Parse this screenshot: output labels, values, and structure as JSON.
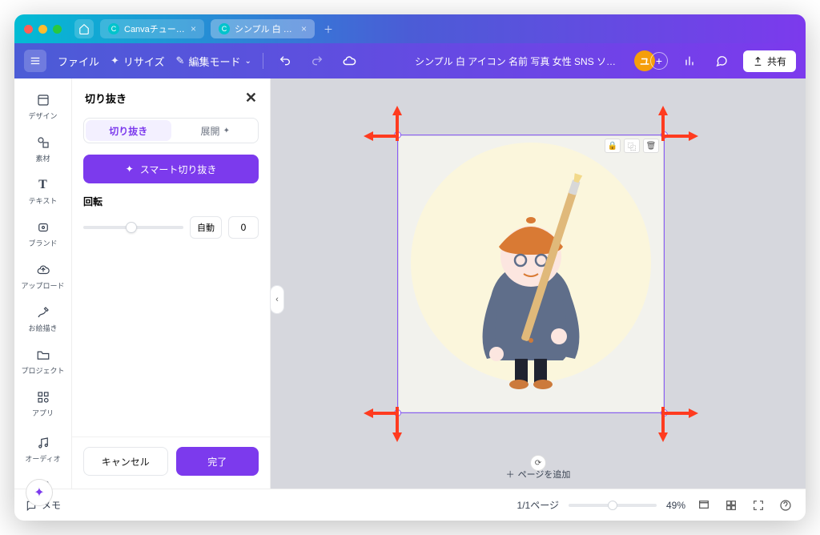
{
  "tabs": [
    {
      "label": "Canvaチュートリア…"
    },
    {
      "label": "シンプル 白 アイ…"
    }
  ],
  "toolbar": {
    "file": "ファイル",
    "resize": "リサイズ",
    "editmode": "編集モード",
    "docname": "シンプル 白 アイコン 名前 写真 女性 SNS ソーシャル…",
    "avatar": "ユ",
    "share": "共有"
  },
  "rail": [
    {
      "name": "design",
      "label": "デザイン",
      "icon": "▭"
    },
    {
      "name": "elements",
      "label": "素材",
      "icon": "✦"
    },
    {
      "name": "text",
      "label": "テキスト",
      "icon": "T"
    },
    {
      "name": "brand",
      "label": "ブランド",
      "icon": "🅱"
    },
    {
      "name": "upload",
      "label": "アップロード",
      "icon": "☁"
    },
    {
      "name": "draw",
      "label": "お絵描き",
      "icon": "✎"
    },
    {
      "name": "project",
      "label": "プロジェクト",
      "icon": "🗀"
    },
    {
      "name": "apps",
      "label": "アプリ",
      "icon": "⊞"
    },
    {
      "name": "audio",
      "label": "オーディオ",
      "icon": "♪"
    },
    {
      "name": "video",
      "label": "",
      "icon": "▣"
    }
  ],
  "panel": {
    "title": "切り抜き",
    "tab_crop": "切り抜き",
    "tab_expand": "展開",
    "smart": "スマート切り抜き",
    "rotation_label": "回転",
    "auto": "自動",
    "rotation_value": "0",
    "cancel": "キャンセル",
    "done": "完了"
  },
  "canvas": {
    "add_page": "ページを追加"
  },
  "footer": {
    "memo": "メモ",
    "page": "1/1ページ",
    "zoom": "49%"
  }
}
